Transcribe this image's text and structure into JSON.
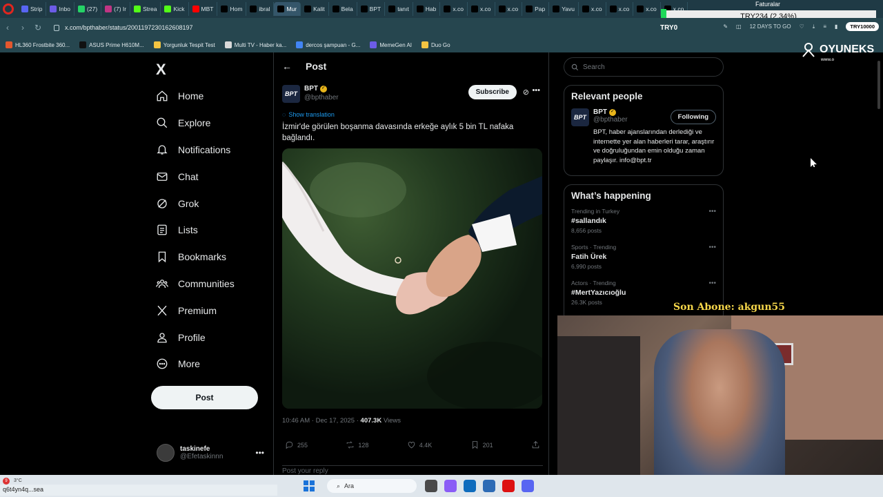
{
  "browser": {
    "tabs": [
      {
        "label": "Strip",
        "color": "#5865f2"
      },
      {
        "label": "Inbo",
        "color": "#6c5ce7"
      },
      {
        "label": "(27)",
        "color": "#25d366"
      },
      {
        "label": "(7) Ir",
        "color": "#c13584"
      },
      {
        "label": "Strea",
        "color": "#53fc18"
      },
      {
        "label": "Kick",
        "color": "#53fc18"
      },
      {
        "label": "MBT",
        "color": "#ff0000"
      },
      {
        "label": "Hom",
        "color": "#000000"
      },
      {
        "label": "ibral",
        "color": "#000000"
      },
      {
        "label": "Mur",
        "color": "#000000",
        "active": true
      },
      {
        "label": "Kalit",
        "color": "#000000"
      },
      {
        "label": "Bela",
        "color": "#000000"
      },
      {
        "label": "BPT",
        "color": "#000000"
      },
      {
        "label": "tanıt",
        "color": "#000000"
      },
      {
        "label": "Hab",
        "color": "#000000"
      },
      {
        "label": "x.co",
        "color": "#000000"
      },
      {
        "label": "x.co",
        "color": "#000000"
      },
      {
        "label": "x.co",
        "color": "#000000"
      },
      {
        "label": "Pap",
        "color": "#000000"
      },
      {
        "label": "Yavu",
        "color": "#000000"
      },
      {
        "label": "x.co",
        "color": "#000000"
      },
      {
        "label": "x.co",
        "color": "#000000"
      },
      {
        "label": "x.co",
        "color": "#000000"
      },
      {
        "label": "x.co",
        "color": "#000000"
      }
    ],
    "url": "x.com/bpthaber/status/2001197230162608197",
    "toolbar_right": {
      "date_label": "12 DAYS TO GO",
      "pill": "TRY10000"
    },
    "bookmarks": [
      {
        "label": "HL360 Frostbite 360...",
        "color": "#e4572e"
      },
      {
        "label": "ASUS Prime H610M...",
        "color": "#111111"
      },
      {
        "label": "Yorgunluk Tespit Test",
        "color": "#f4c542"
      },
      {
        "label": "Multi TV - Haber ka...",
        "color": "#d9d9d9"
      },
      {
        "label": "dercos şampuan - G...",
        "color": "#4285f4"
      },
      {
        "label": "MemeGen AI",
        "color": "#6c5ce7"
      },
      {
        "label": "Duo Go",
        "color": "#f4c542"
      }
    ]
  },
  "overlay": {
    "ticker_label": "Faturalar",
    "ticker_text": "TRY234 (2.34%)",
    "ticker_code": "TRY0",
    "brand": "OYUNEKS",
    "brand_sub": "www.o",
    "sub_banner": "Son Abone: akgun55"
  },
  "x": {
    "logo": "X",
    "nav": [
      {
        "label": "Home",
        "icon": "home-icon"
      },
      {
        "label": "Explore",
        "icon": "search-icon"
      },
      {
        "label": "Notifications",
        "icon": "bell-icon"
      },
      {
        "label": "Chat",
        "icon": "mail-icon"
      },
      {
        "label": "Grok",
        "icon": "grok-icon"
      },
      {
        "label": "Lists",
        "icon": "list-icon"
      },
      {
        "label": "Bookmarks",
        "icon": "bookmark-icon"
      },
      {
        "label": "Communities",
        "icon": "communities-icon"
      },
      {
        "label": "Premium",
        "icon": "x-premium-icon"
      },
      {
        "label": "Profile",
        "icon": "profile-icon"
      },
      {
        "label": "More",
        "icon": "more-circle-icon"
      }
    ],
    "post_button": "Post",
    "account": {
      "name": "taskinefe",
      "handle": "@Efetaskinnn"
    }
  },
  "main": {
    "title": "Post",
    "author": {
      "name": "BPT",
      "handle": "@bpthaber",
      "avatar_text": "BPT"
    },
    "subscribe": "Subscribe",
    "show_translation": "Show translation",
    "text": "İzmir'de görülen boşanma davasında erkeğe aylık 5 bin TL nafaka bağlandı.",
    "meta": {
      "time": "10:46 AM · Dec 17, 2025 · ",
      "views": "407.3K",
      "views_label": " Views"
    },
    "actions": {
      "replies": "255",
      "reposts": "128",
      "likes": "4.4K",
      "bookmarks": "201"
    },
    "reply_placeholder": "Post your reply"
  },
  "sidebar": {
    "search_placeholder": "Search",
    "relevant_title": "Relevant people",
    "relevant": {
      "name": "BPT",
      "handle": "@bpthaber",
      "button": "Following",
      "bio": "BPT, haber ajanslarından derlediği ve internette yer alan haberleri tarar, araştırır ve doğruluğundan emin olduğu zaman paylaşır. info@bpt.tr"
    },
    "happening_title": "What’s happening",
    "trends": [
      {
        "context": "Trending in Turkey",
        "name": "#sallandık",
        "count": "8,656 posts"
      },
      {
        "context": "Sports · Trending",
        "name": "Fatih Ürek",
        "count": "6,990 posts"
      },
      {
        "context": "Actors · Trending",
        "name": "#MertYazıcıoğlu",
        "count": "26.3K posts"
      }
    ]
  },
  "taskbar": {
    "weather_badge": "9",
    "weather": "3°C",
    "status_url": "q6t4yn4q...sea",
    "search": "Ara"
  }
}
